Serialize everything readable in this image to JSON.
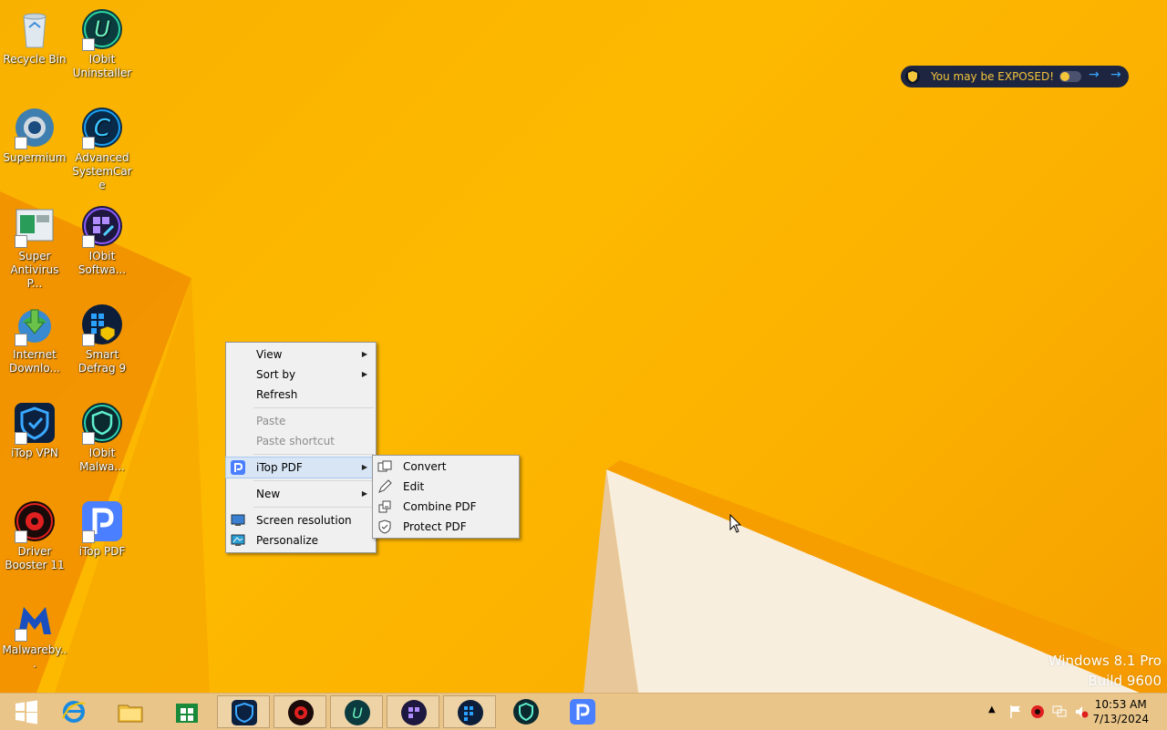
{
  "desktop_icons": [
    {
      "label": "Recycle Bin",
      "icon": "recycle-bin-icon"
    },
    {
      "label": "IObit Uninstaller",
      "icon": "iobit-uninstaller-icon"
    },
    {
      "label": "Supermium",
      "icon": "supermium-icon"
    },
    {
      "label": "Advanced SystemCare",
      "icon": "advanced-systemcare-icon"
    },
    {
      "label": "Super Antivirus P...",
      "icon": "super-antivirus-icon"
    },
    {
      "label": "IObit Softwa...",
      "icon": "iobit-software-updater-icon"
    },
    {
      "label": "Internet Downlo...",
      "icon": "internet-download-manager-icon"
    },
    {
      "label": "Smart Defrag 9",
      "icon": "smart-defrag-icon"
    },
    {
      "label": "iTop VPN",
      "icon": "itop-vpn-icon"
    },
    {
      "label": "IObit Malwa...",
      "icon": "iobit-malware-fighter-icon"
    },
    {
      "label": "Driver Booster 11",
      "icon": "driver-booster-icon"
    },
    {
      "label": "iTop PDF",
      "icon": "itop-pdf-icon"
    },
    {
      "label": "Malwareby...",
      "icon": "malwarebytes-icon"
    }
  ],
  "context_menu": {
    "items": [
      {
        "label": "View"
      },
      {
        "label": "Sort by"
      },
      {
        "label": "Refresh"
      },
      {
        "label": "Paste"
      },
      {
        "label": "Paste shortcut"
      },
      {
        "label": "iTop PDF"
      },
      {
        "label": "New"
      },
      {
        "label": "Screen resolution"
      },
      {
        "label": "Personalize"
      }
    ]
  },
  "submenu": {
    "items": [
      {
        "label": "Convert"
      },
      {
        "label": "Edit"
      },
      {
        "label": "Combine PDF"
      },
      {
        "label": "Protect PDF"
      }
    ]
  },
  "toast": {
    "text": "You may be EXPOSED!"
  },
  "watermark": {
    "line1": "Windows 8.1 Pro",
    "line2": "Build 9600"
  },
  "clock": {
    "time": "10:53 AM",
    "date": "7/13/2024"
  },
  "colors": {
    "accent": "#fdb900",
    "menu_highlight": "#d7e5f5"
  }
}
